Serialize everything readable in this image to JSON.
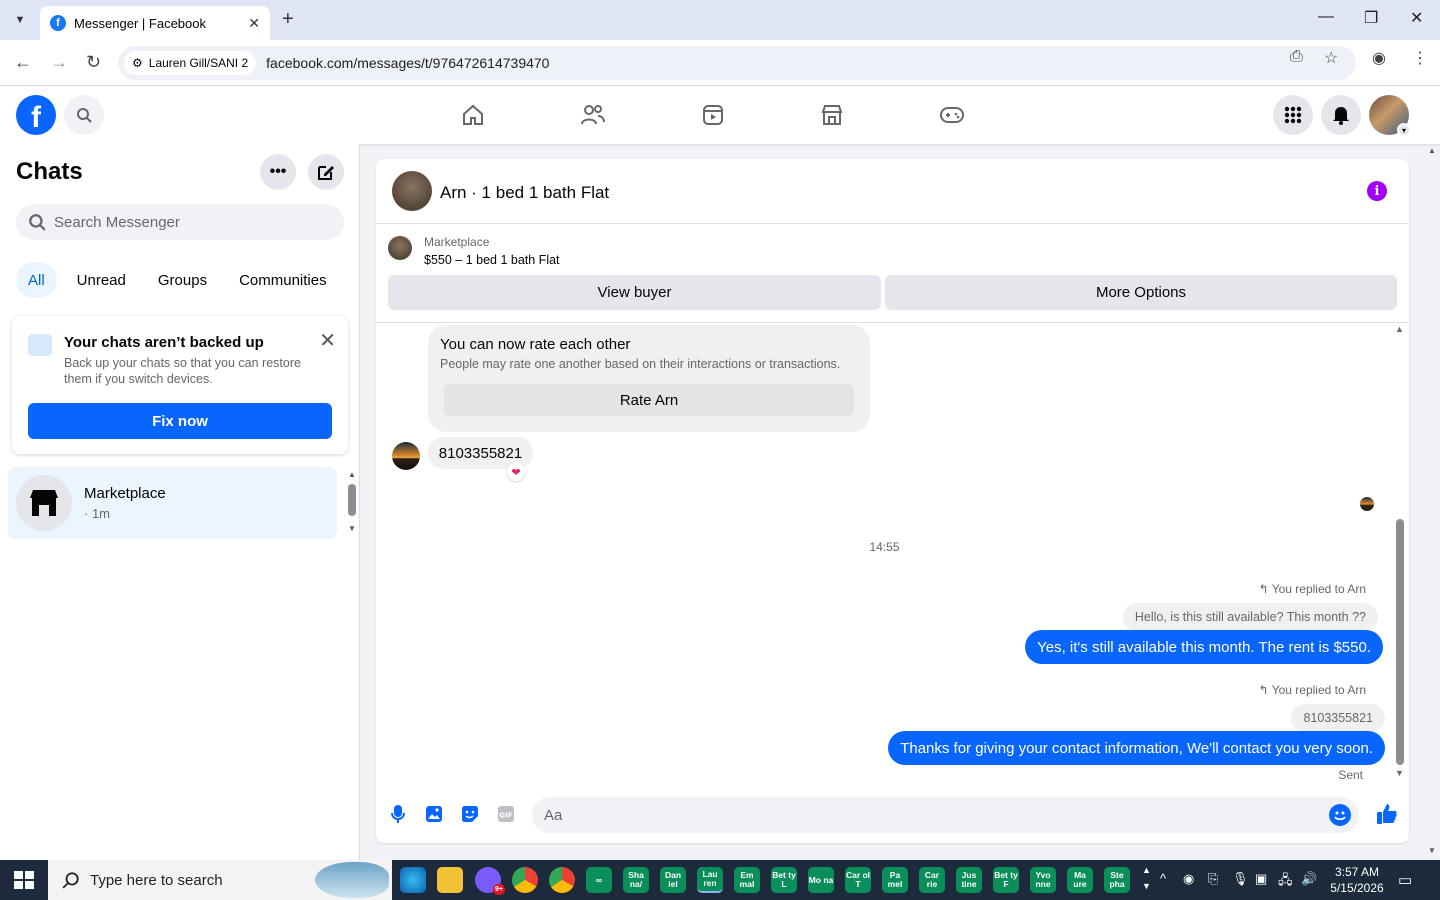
{
  "browser": {
    "tab_title": "Messenger | Facebook",
    "site_chip": "Lauren Gill/SANI 2",
    "url": "facebook.com/messages/t/976472614739470"
  },
  "sidebar": {
    "title": "Chats",
    "search_placeholder": "Search Messenger",
    "filters": [
      "All",
      "Unread",
      "Groups",
      "Communities"
    ],
    "backup_notice": {
      "title": "Your chats aren’t backed up",
      "description": "Back up your chats so that you can restore them if you switch devices.",
      "button": "Fix now"
    },
    "chats": [
      {
        "name": "Marketplace",
        "time": "· 1m"
      }
    ]
  },
  "conversation": {
    "title": "Arn · 1 bed 1 bath Flat",
    "marketplace_label": "Marketplace",
    "listing": "$550 – 1 bed 1 bath Flat",
    "view_buyer": "View buyer",
    "more_options": "More Options",
    "rate_card": {
      "heading": "You can now rate each other",
      "description": "People may rate one another based on their interactions or transactions.",
      "button": "Rate Arn"
    },
    "incoming_message": "8103355821",
    "timestamp": "14:55",
    "replies": [
      {
        "label": "You replied to Arn",
        "quoted": "Hello, is this still available? This month ??",
        "message": "Yes, it's still available this month. The rent is $550."
      },
      {
        "label": "You replied to Arn",
        "quoted": "8103355821",
        "message": "Thanks for giving your contact information, We'll contact you very soon."
      }
    ],
    "status": "Sent",
    "composer_placeholder": "Aa"
  },
  "taskbar": {
    "search_placeholder": "Type here to search",
    "pinned_labels": [
      "Sha na/",
      "Dan iel",
      "Lau ren",
      "Em mal",
      "Bet ty L",
      "Mo na",
      "Car ol T",
      "Pa mel",
      "Car rie",
      "Jus tine",
      "Bet ty F",
      "Yvo nne",
      "Ma ure",
      "Ste pha"
    ],
    "badge": "9+",
    "time": "3:57 AM",
    "date": "5/15/2026"
  },
  "colors": {
    "accent": "#0866ff",
    "info": "#a200f5",
    "heart": "#e0245e"
  }
}
